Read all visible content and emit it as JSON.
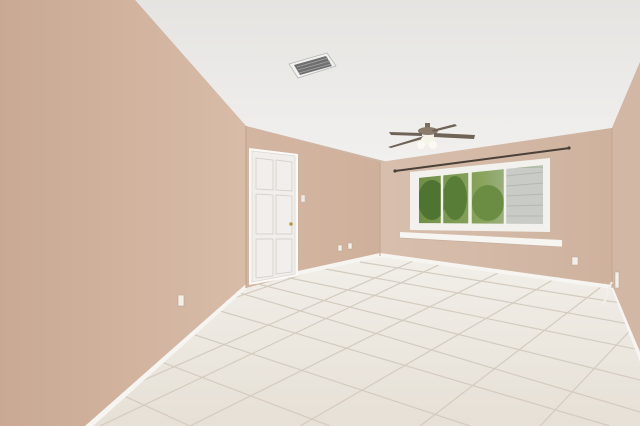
{
  "scene": {
    "subject": "empty-room-interior",
    "colors": {
      "wall_left": "#cfb19b",
      "wall_back": "#d2b4a0",
      "wall_right": "#d6bca9",
      "ceiling": "#ecebe8",
      "floor_tile": "#ece7df",
      "grout": "#d6cec3",
      "trim": "#f6f4f0",
      "door": "#f3f2ef",
      "greenery": "#5c7d3a",
      "vent": "#8d8d8d",
      "fan_blade": "#7a6d60",
      "fan_light": "#f5f2e7"
    },
    "icons": [
      "ceiling-fan-icon",
      "air-vent-icon",
      "outlet-icon",
      "door-knob-icon"
    ]
  }
}
